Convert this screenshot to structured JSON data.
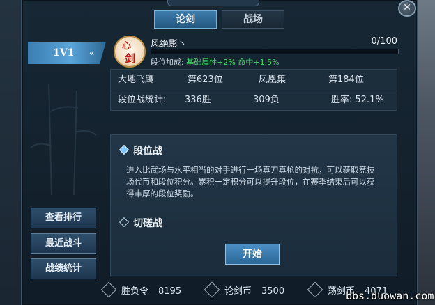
{
  "window": {
    "close_icon": "close-icon"
  },
  "tabs": [
    {
      "label": "论剑",
      "active": true
    },
    {
      "label": "战场",
      "active": false
    }
  ],
  "side_tab": {
    "label": "1V1",
    "arrow": "«"
  },
  "player": {
    "emblem_chars": [
      "心",
      "剑"
    ],
    "name": "风绝影丶",
    "progress_text": "0/100",
    "progress": 0,
    "bonus_label": "段位加成:",
    "bonus_value": "基础属性+2% 命中+1.5%"
  },
  "stats": {
    "row1": [
      "大地飞鹰",
      "第623位",
      "凤凰集",
      "第184位"
    ],
    "row2": [
      "段位战统计:",
      "336胜",
      "309负",
      "胜率: 52.1%"
    ]
  },
  "modes": [
    {
      "title": "段位战",
      "selected": true,
      "desc": "进入比武场与水平相当的对手进行一场真刀真枪的对抗，可以获取竞技场代币和段位积分。累积一定积分可以提升段位，在赛季结束后可以获得丰厚的段位奖励。"
    },
    {
      "title": "切磋战",
      "selected": false,
      "desc": ""
    }
  ],
  "buttons": {
    "ranking": "查看排行",
    "recent": "最近战斗",
    "record": "战绩统计",
    "start": "开始"
  },
  "currencies": [
    {
      "name": "胜负令",
      "amount": "8195"
    },
    {
      "name": "论剑币",
      "amount": "3500"
    },
    {
      "name": "荡剑币",
      "amount": "4071"
    }
  ],
  "watermark": "bbs.duowan.com",
  "colors": {
    "accent": "#3d7cab",
    "bonus_green": "#49d86a",
    "progress": "#6ab4ff"
  }
}
